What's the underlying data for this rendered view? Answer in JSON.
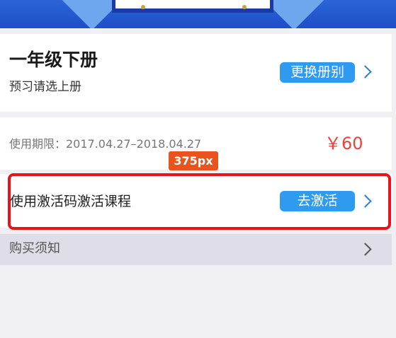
{
  "grade": {
    "title": "一年级下册",
    "subtitle": "预习请选上册",
    "change_button": "更换册别"
  },
  "price_info": {
    "validity": "使用期限：2017.04.27–2018.04.27",
    "price": "￥60"
  },
  "measure_badge": "375px",
  "activation": {
    "label": "使用激活码激活课程",
    "button": "去激活"
  },
  "notice": {
    "label": "购买须知"
  },
  "colors": {
    "accent_blue": "#2f9bf0",
    "price_red": "#f0413d",
    "highlight_red": "#e8141a",
    "badge_orange": "#e8531e"
  },
  "icons": [
    "chevron-right-icon",
    "chevron-right-icon",
    "chevron-right-icon"
  ]
}
